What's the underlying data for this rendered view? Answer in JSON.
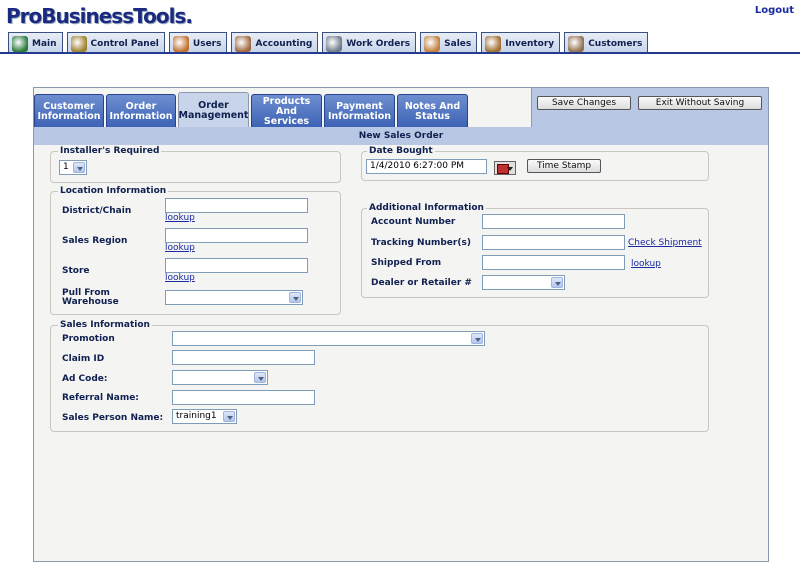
{
  "header": {
    "logo": "ProBusinessTools.",
    "logout": "Logout"
  },
  "nav": [
    {
      "label": "Main",
      "icon": "globe-icon",
      "color": "#2a7a3a"
    },
    {
      "label": "Control Panel",
      "icon": "tools-icon",
      "color": "#a08030"
    },
    {
      "label": "Users",
      "icon": "users-icon",
      "color": "#c07030"
    },
    {
      "label": "Accounting",
      "icon": "accountant-icon",
      "color": "#a06840"
    },
    {
      "label": "Work Orders",
      "icon": "truck-icon",
      "color": "#707a8a"
    },
    {
      "label": "Sales",
      "icon": "sales-icon",
      "color": "#c08040"
    },
    {
      "label": "Inventory",
      "icon": "box-icon",
      "color": "#a07030"
    },
    {
      "label": "Customers",
      "icon": "customers-icon",
      "color": "#907050"
    }
  ],
  "tabs": [
    {
      "label": "Customer Information",
      "active": false
    },
    {
      "label": "Order Information",
      "active": false
    },
    {
      "label": "Order Management",
      "active": true
    },
    {
      "label": "Products And Services",
      "active": false
    },
    {
      "label": "Payment Information",
      "active": false
    },
    {
      "label": "Notes And Status",
      "active": false
    }
  ],
  "actions": {
    "save": "Save Changes",
    "exit": "Exit Without Saving"
  },
  "title": "New Sales Order",
  "installers": {
    "legend": "Installer's Required",
    "value": "1"
  },
  "date_bought": {
    "legend": "Date Bought",
    "value": "1/4/2010 6:27:00 PM",
    "timestamp": "Time Stamp"
  },
  "location": {
    "legend": "Location Information",
    "district": "District/Chain",
    "region": "Sales Region",
    "store": "Store",
    "warehouse_1": "Pull From",
    "warehouse_2": "Warehouse",
    "lookup": "lookup"
  },
  "additional": {
    "legend": "Additional Information",
    "account": "Account Number",
    "tracking": "Tracking Number(s)",
    "check": "Check Shipment",
    "shipped": "Shipped From",
    "lookup": "lookup",
    "dealer": "Dealer or Retailer #"
  },
  "sales": {
    "legend": "Sales Information",
    "promotion": "Promotion",
    "claim": "Claim ID",
    "adcode": "Ad Code:",
    "referral": "Referral Name:",
    "person": "Sales Person Name:",
    "person_value": "training1"
  }
}
